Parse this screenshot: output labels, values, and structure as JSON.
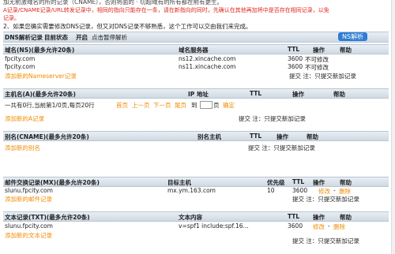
{
  "notice": {
    "line0": "加无前激域名的所的记录（CNAME），否则将面的 · 切超域有的所有都在前有更生。",
    "line1": "A记录/CNAME记录/URL转发记录中，相同的指向只能存在一条，请在新指向的同时，先确认在其他再加将中是否存在相同记录，以免",
    "line1_suffix": "记录。",
    "line2": "2、如果您确实需要修改DNS记录，但又对DNS记录不够熟悉，这个工作可以交由我们来完成。"
  },
  "dns_status": {
    "label": "DNS解析记录",
    "status_label": "目前状态",
    "status_value": "开启",
    "pause_link": "点击暂停解析",
    "button": "NS解析"
  },
  "ns": {
    "headers": [
      "域名(NS)(最多允许20条)",
      "域名服务器",
      "TTL",
      "操作",
      "帮助"
    ],
    "rows": [
      {
        "domain": "fpcity.com",
        "server": "ns12.xincache.com",
        "ttl": "3600",
        "op": "不可修改"
      },
      {
        "domain": "fpcity.com",
        "server": "ns11.xincache.com",
        "ttl": "3600",
        "op": "不可修改"
      }
    ],
    "add_link": "添加新的Nameserver记录",
    "submit_note": "提交 注：只提交新加记录"
  },
  "a": {
    "headers": [
      "主机名(A)(最多允许20条)",
      "IP 地址",
      "TTL",
      "操作",
      "帮助"
    ],
    "pager": {
      "text": "一共有0行,当前第1/0页,每页20行",
      "first": "首页",
      "prev": "上一页",
      "next": "下一页",
      "last": "尾页",
      "goto": "到",
      "page_unit": "页",
      "confirm": "确定"
    },
    "add_link": "添加新的A记录",
    "submit_note": "提交 注：只提交新加记录"
  },
  "cname": {
    "headers": [
      "别名(CNAME)(最多允许20条)",
      "别名主机",
      "TTL",
      "操作",
      "帮助"
    ],
    "add_link": "添加新的别名",
    "submit_note": "提交 注：只提交新加记录"
  },
  "mx": {
    "headers": [
      "邮件交换记录(MX)(最多允许20条)",
      "目标主机",
      "优先级",
      "TTL",
      "操作",
      "帮助"
    ],
    "rows": [
      {
        "host": "slunu.fpcity.com",
        "target": "mx.ym.163.com",
        "priority": "10",
        "ttl": "3600",
        "edit": "修改",
        "dash": "-",
        "delete": "删除"
      }
    ],
    "add_link": "添加新的邮件记录",
    "submit_note": "提交 注：只提交新加记录"
  },
  "txt": {
    "headers": [
      "文本记录(TXT)(最多允许20条)",
      "文本内容",
      "TTL",
      "操作",
      "帮助"
    ],
    "rows": [
      {
        "host": "slunu.fpcity.com",
        "content": "v=spf1 include:spf.16...",
        "ttl": "3600",
        "edit": "修改",
        "dash": "-",
        "delete": "删除"
      }
    ],
    "add_link": "添加新的文本记录",
    "submit_note": "提交 注：只提交新加记录"
  },
  "colors": {
    "accent": "#f08c00",
    "alert": "#e0281e",
    "button": "#2d7cd6",
    "header_bg": "#d7e0e9"
  }
}
